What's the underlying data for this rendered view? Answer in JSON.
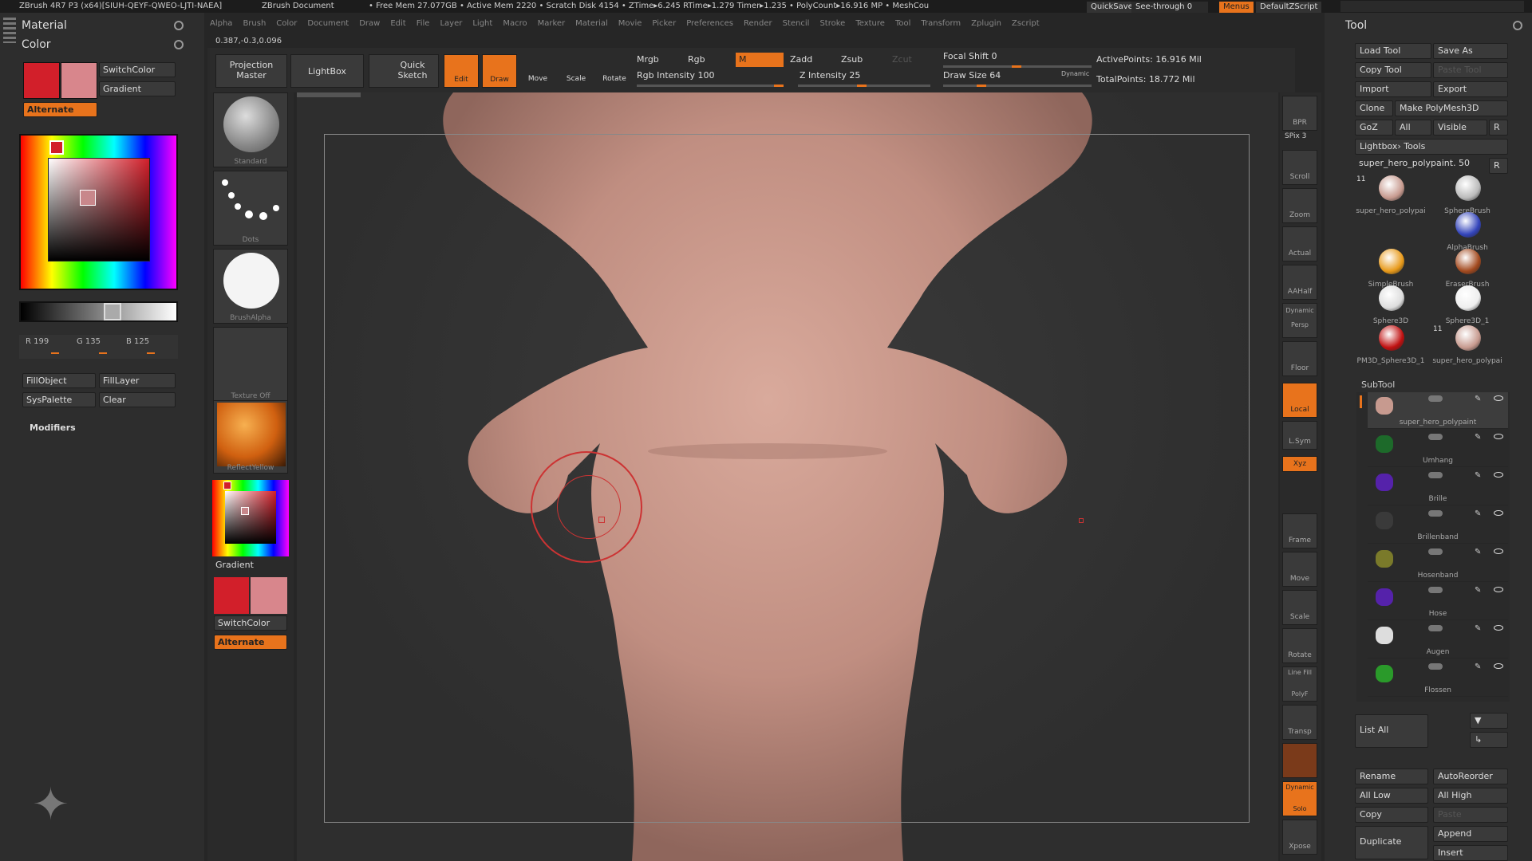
{
  "titlebar": {
    "app": "ZBrush 4R7 P3 (x64)[SIUH-QEYF-QWEO-LJTI-NAEA]",
    "document": "ZBrush Document",
    "stats": "• Free Mem 27.077GB • Active Mem 2220 • Scratch Disk 4154 • ZTime▸6.245 RTime▸1.279 Timer▸1.235 • PolyCount▸16.916 MP • MeshCou",
    "quicksave": "QuickSave",
    "seethrough": "See-through  0",
    "menus": "Menus",
    "zscript": "DefaultZScript"
  },
  "menubar": [
    "Alpha",
    "Brush",
    "Color",
    "Document",
    "Draw",
    "Edit",
    "File",
    "Layer",
    "Light",
    "Macro",
    "Marker",
    "Material",
    "Movie",
    "Picker",
    "Preferences",
    "Render",
    "Stencil",
    "Stroke",
    "Texture",
    "Tool",
    "Transform",
    "Zplugin",
    "Zscript"
  ],
  "coords": "0.387,-0.3,0.096",
  "left": {
    "material_label": "Material",
    "color_label": "Color",
    "switchcolor": "SwitchColor",
    "gradient": "Gradient",
    "alternate": "Alternate",
    "primary_color": "#d21f2a",
    "secondary_color": "#d8868c",
    "r": "R 199",
    "g": "G 135",
    "b": "B 125",
    "fillobject": "FillObject",
    "filllayer": "FillLayer",
    "syspalette": "SysPalette",
    "clear": "Clear",
    "modifiers": "Modifiers"
  },
  "col2": {
    "standard": "Standard",
    "dots": "Dots",
    "brushalpha": "BrushAlpha",
    "texture_off": "Texture Off",
    "reflectyellow": "ReflectYellow",
    "gradient": "Gradient",
    "switchcolor": "SwitchColor",
    "alternate": "Alternate"
  },
  "shelf": {
    "projection_master": "Projection Master",
    "lightbox": "LightBox",
    "quick_sketch": "Quick Sketch",
    "edit": "Edit",
    "draw": "Draw",
    "move": "Move",
    "scale": "Scale",
    "rotate": "Rotate",
    "mrgb": "Mrgb",
    "rgb": "Rgb",
    "m": "M",
    "zadd": "Zadd",
    "zsub": "Zsub",
    "zcut": "Zcut",
    "rgb_intensity": "Rgb Intensity 100",
    "z_intensity": "Z Intensity 25",
    "focal_shift": "Focal Shift 0",
    "draw_size": "Draw Size 64",
    "dynamic": "Dynamic",
    "active_points": "ActivePoints: 16.916 Mil",
    "total_points": "TotalPoints: 18.772 Mil"
  },
  "right_toolbar": {
    "bpr": "BPR",
    "spix": "SPix 3",
    "scroll": "Scroll",
    "zoom": "Zoom",
    "actual": "Actual",
    "aahalf": "AAHalf",
    "dynamic": "Dynamic",
    "persp": "Persp",
    "floor": "Floor",
    "local": "Local",
    "lsym": "L.Sym",
    "xyz": "Xyz",
    "frame": "Frame",
    "move": "Move",
    "scale": "Scale",
    "rotate": "Rotate",
    "linefill": "Line Fill",
    "polyf": "PolyF",
    "transp": "Transp",
    "dynamic2": "Dynamic",
    "solo": "Solo",
    "xpose": "Xpose"
  },
  "tool": {
    "title": "Tool",
    "load_tool": "Load Tool",
    "save_as": "Save As",
    "copy_tool": "Copy Tool",
    "paste_tool": "Paste Tool",
    "import": "Import",
    "export": "Export",
    "clone": "Clone",
    "make_polymesh": "Make PolyMesh3D",
    "goz": "GoZ",
    "all": "All",
    "visible": "Visible",
    "r": "R",
    "lightbox_tools": "Lightbox› Tools",
    "current_tool": "super_hero_polypaint. 50",
    "thumbnails": [
      {
        "name": "super_hero_polypai",
        "color": "#c79a8f",
        "count": "11"
      },
      {
        "name": "SphereBrush",
        "color": "#bbbbbb"
      },
      {
        "name": "AlphaBrush",
        "color": "#3344bb"
      },
      {
        "name": "SimpleBrush",
        "color": "#e89a1a"
      },
      {
        "name": "EraserBrush",
        "color": "#a34a1f"
      },
      {
        "name": "Sphere3D",
        "color": "#dddddd"
      },
      {
        "name": "Sphere3D_1",
        "color": "#eeeeee"
      },
      {
        "name": "PM3D_Sphere3D_1",
        "color": "#c01010"
      },
      {
        "name": "super_hero_polypai",
        "color": "#c79a8f",
        "count": "11"
      }
    ],
    "subtool_label": "SubTool",
    "subtools": [
      {
        "name": "super_hero_polypaint",
        "color": "#c79a8f"
      },
      {
        "name": "Umhang",
        "color": "#1d6a2a"
      },
      {
        "name": "Brille",
        "color": "#5522aa"
      },
      {
        "name": "Brillenband",
        "color": "#3a3a3a"
      },
      {
        "name": "Hosenband",
        "color": "#7a7a2a"
      },
      {
        "name": "Hose",
        "color": "#5522aa"
      },
      {
        "name": "Augen",
        "color": "#dddddd"
      },
      {
        "name": "Flossen",
        "color": "#2a9a2a"
      }
    ],
    "list_all": "List All",
    "rename": "Rename",
    "autoreorder": "AutoReorder",
    "all_low": "All Low",
    "all_high": "All High",
    "copy": "Copy",
    "paste": "Paste",
    "duplicate": "Duplicate",
    "append": "Append",
    "insert": "Insert"
  }
}
